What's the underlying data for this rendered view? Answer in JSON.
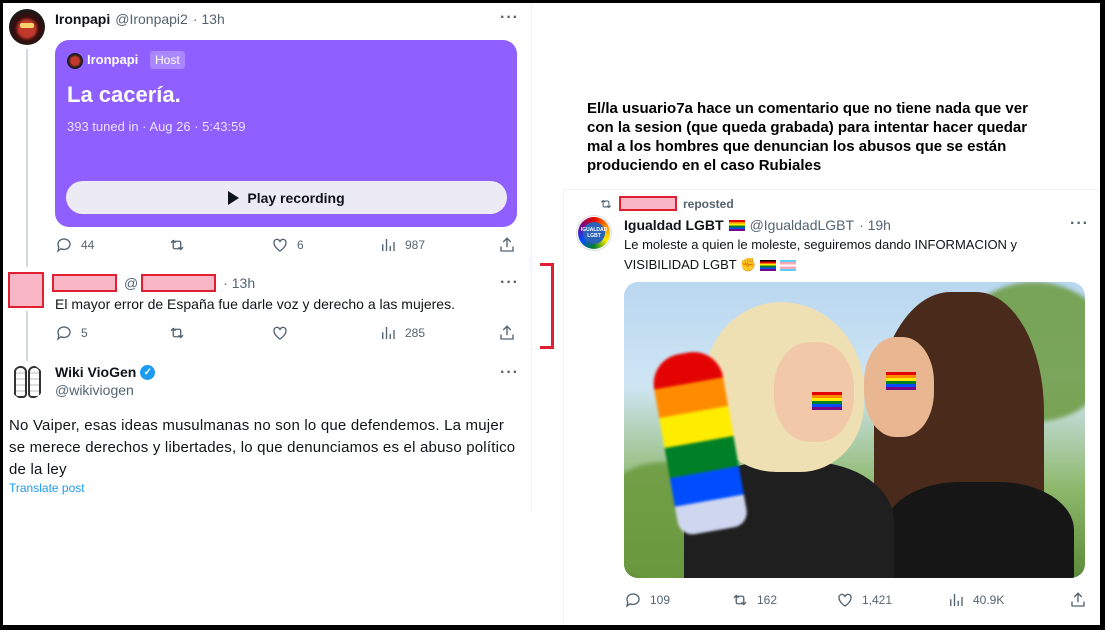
{
  "left": {
    "post1": {
      "name": "Ironpapi",
      "handle": "@Ironpapi2",
      "time": "· 13h",
      "more": "···",
      "space": {
        "host_name": "Ironpapi",
        "host_badge": "Host",
        "title": "La cacería.",
        "meta": "393 tuned in · Aug 26 · 5:43:59",
        "play_label": "Play recording"
      },
      "stats": {
        "replies": "44",
        "reposts": "",
        "likes": "6",
        "views": "987"
      }
    },
    "post2": {
      "at": "@",
      "time": "· 13h",
      "more": "···",
      "text": "El mayor error de España fue darle voz y derecho a las mujeres.",
      "stats": {
        "replies": "5",
        "reposts": "",
        "likes": "",
        "views": "285"
      }
    },
    "post3": {
      "name": "Wiki VioGen",
      "handle": "@wikiviogen",
      "verified_mark": "✓",
      "more": "···",
      "text": "No Vaiper, esas ideas musulmanas no son lo que defendemos. La mujer se merece derechos y libertades, lo que denunciamos es el abuso político de la ley",
      "translate": "Translate post"
    }
  },
  "right": {
    "caption": "El/la usuario7a hace un comentario que no tiene nada que ver con la sesion (que queda grabada) para intentar hacer quedar mal a los hombres que denuncian los abusos que se están produciendo en el caso Rubiales",
    "reposted_label": "reposted",
    "post": {
      "name": "Igualdad LGBT",
      "handle": "@IgualdadLGBT",
      "time": "· 19h",
      "more": "···",
      "avatar_text": "IGUALDAD LGBT",
      "text_line1": "Le moleste a quien le moleste,  seguiremos dando INFORMACION y",
      "text_line2": "VISIBILIDAD LGBT ✊",
      "stats": {
        "replies": "109",
        "reposts": "162",
        "likes": "1,421",
        "views": "40.9K"
      }
    }
  },
  "colors": {
    "space_purple": "#8f5fff",
    "redaction_fill": "#f9b6c6",
    "redaction_border": "#e02030",
    "link_blue": "#1d9bf0",
    "muted": "#536471"
  }
}
